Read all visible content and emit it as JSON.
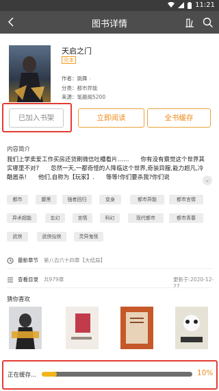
{
  "status_bar": {
    "time": "11:21"
  },
  "nav": {
    "title": "图书详情"
  },
  "book": {
    "title": "天启之门",
    "status_tag": "完本",
    "author_label": "作者：",
    "author": "跳舞",
    "category_label": "分类：",
    "category": "都市异能",
    "source_label": "来源：",
    "source": "笔趣阁5200"
  },
  "actions": {
    "add_shelf": "已加入书架",
    "read_now": "立即阅读",
    "cache_all": "全书缓存"
  },
  "intro": {
    "heading": "内容简介",
    "text": "我们上学卖爱工作买房还贷刷微信吐槽看片……　　你有没有察觉这个世界其实哪里不对?　　忽然一天,一都奇怪的人降临这个世界,奇装异服,能力超凡,冷酷嚣杀!　　他们,自称为【玩家】.　　等等!你们要杀我?你们说"
  },
  "tags": [
    "都市",
    "腹黑",
    "强者回归",
    "变身",
    "都市异能",
    "都市言情",
    "异术超能",
    "玄幻",
    "言情",
    "科幻",
    "现代都市",
    "都市青春",
    "武侠",
    "武侠仙侠",
    "灵异鬼怪"
  ],
  "latest": {
    "label": "最新章节",
    "value": "第八百六十四章【大结局】"
  },
  "catalog": {
    "label": "查看目录",
    "count": "共979章",
    "updated": "更新于:2020-12-27"
  },
  "recommend": {
    "heading": "猜你喜欢"
  },
  "progress": {
    "label": "正在缓存...",
    "percent_text": "10%",
    "fraction": 0.1
  },
  "colors": {
    "accent": "#ef8b1a",
    "nav_bg": "#4d4d4d",
    "highlight_box": "#e23b32",
    "progress_fill": "#f3b518"
  }
}
